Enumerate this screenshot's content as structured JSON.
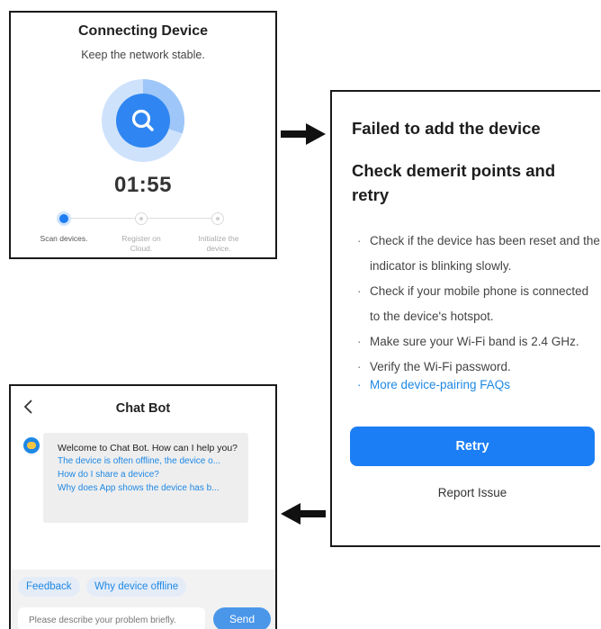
{
  "connecting": {
    "title": "Connecting Device",
    "subtitle": "Keep the network stable.",
    "timer": "01:55",
    "steps": [
      {
        "label": "Scan devices.",
        "state": "active"
      },
      {
        "label": "Register on Cloud.",
        "state": "pending"
      },
      {
        "label": "Initialize the device.",
        "state": "pending"
      }
    ],
    "progress": 0.3,
    "icon": "search-icon"
  },
  "failed": {
    "title": "Failed to add the device",
    "subtitle": "Check demerit points and retry",
    "tips": [
      "Check if the device has been reset and the indicator is blinking slowly.",
      "Check if your mobile phone is connected to the device's hotspot.",
      "Make sure your Wi-Fi band is 2.4 GHz.",
      "Verify the Wi-Fi password."
    ],
    "faq_link": "More device-pairing FAQs",
    "retry_label": "Retry",
    "report_label": "Report Issue"
  },
  "chatbot": {
    "title": "Chat Bot",
    "back_icon": "chevron-left-icon",
    "welcome": "Welcome to Chat Bot. How can I help you?",
    "questions": [
      "The device is often offline, the device o...",
      "How do I share a device?",
      "Why does App shows the device has b..."
    ],
    "chips": [
      "Feedback",
      "Why device offline"
    ],
    "input_placeholder": "Please describe your problem briefly.",
    "send_label": "Send"
  },
  "colors": {
    "accent": "#1c7ef4",
    "link": "#1e88e5",
    "ring_light": "#b9d6fb"
  }
}
